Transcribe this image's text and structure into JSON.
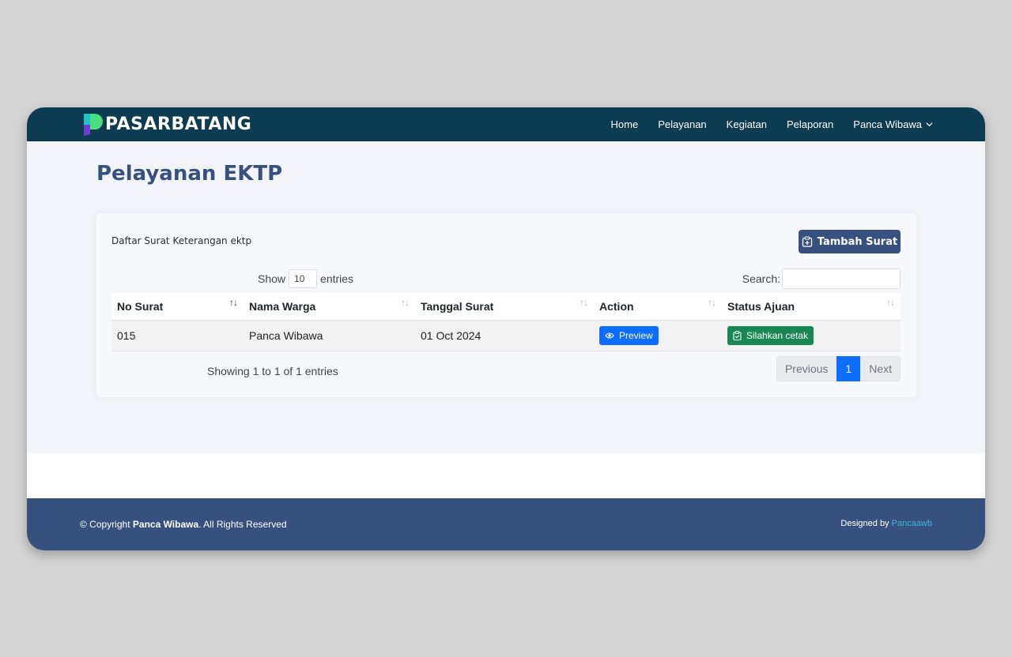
{
  "brand": {
    "name": "PASARBATANG"
  },
  "nav": {
    "items": [
      {
        "label": "Home"
      },
      {
        "label": "Pelayanan"
      },
      {
        "label": "Kegiatan"
      },
      {
        "label": "Pelaporan"
      }
    ],
    "user": {
      "label": "Panca Wibawa"
    }
  },
  "page": {
    "title": "Pelayanan EKTP"
  },
  "card": {
    "title": "Daftar Surat Keterangan ektp",
    "add_button": "Tambah Surat"
  },
  "table_controls": {
    "show_label": "Show",
    "entries_value": "10",
    "entries_label": "entries",
    "search_label": "Search:",
    "search_value": ""
  },
  "table": {
    "headers": [
      "No Surat",
      "Nama Warga",
      "Tanggal Surat",
      "Action",
      "Status Ajuan"
    ],
    "rows": [
      {
        "no_surat": "015",
        "nama_warga": "Panca Wibawa",
        "tanggal_surat": "01 Oct 2024",
        "action": "Preview",
        "status": "Silahkan cetak"
      }
    ]
  },
  "footer_table": {
    "info": "Showing 1 to 1 of 1 entries",
    "previous": "Previous",
    "current_page": "1",
    "next": "Next"
  },
  "footer": {
    "copyright_prefix": "© Copyright",
    "owner": "Panca Wibawa",
    "rights": ". All Rights Reserved",
    "designed_prefix": "Designed by",
    "designer": "Pancaawb"
  },
  "colors": {
    "navbar": "#0d3b52",
    "accent": "#37517e",
    "primary": "#0d6efd",
    "success": "#198754",
    "link": "#47b2e4"
  }
}
